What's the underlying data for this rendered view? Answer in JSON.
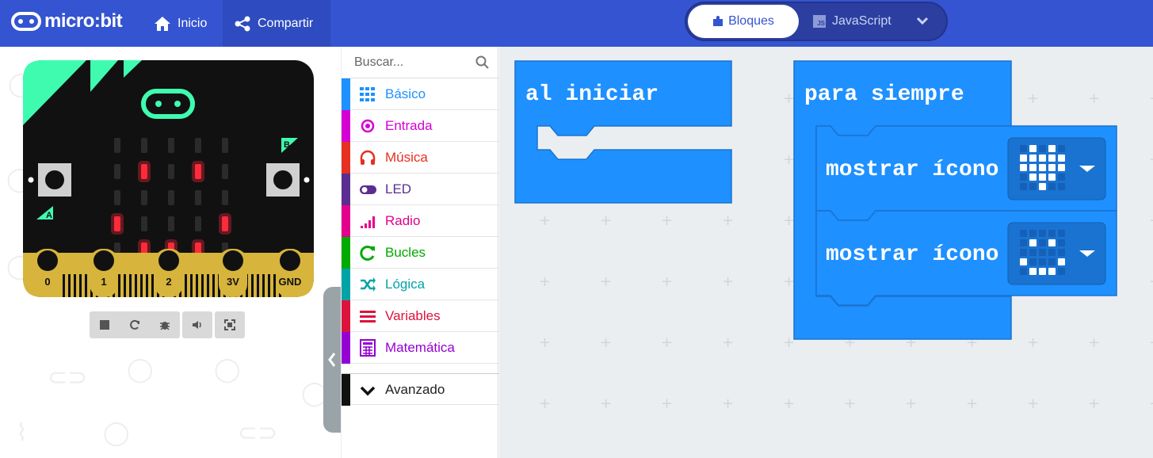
{
  "header": {
    "logo_text": "micro:bit",
    "home_label": "Inicio",
    "share_label": "Compartir",
    "blocks_label": "Bloques",
    "js_label": "JavaScript",
    "js_box": "JS"
  },
  "simulator": {
    "pins": [
      "0",
      "1",
      "2",
      "3V",
      "GND"
    ],
    "button_a": "A",
    "button_b": "B",
    "led_on": [
      [
        1,
        1
      ],
      [
        1,
        3
      ],
      [
        3,
        0
      ],
      [
        3,
        4
      ],
      [
        4,
        1
      ],
      [
        4,
        2
      ],
      [
        4,
        3
      ]
    ],
    "colors": {
      "board": "#111111",
      "accent": "#3ffbb0",
      "gold": "#d7b43b",
      "led": "#ff2a3a"
    }
  },
  "toolbox": {
    "search_placeholder": "Buscar...",
    "categories": [
      {
        "label": "Básico",
        "color": "#1e90ff",
        "icon": "grid-icon"
      },
      {
        "label": "Entrada",
        "color": "#d400d4",
        "icon": "target-icon"
      },
      {
        "label": "Música",
        "color": "#e63022",
        "icon": "headphones-icon"
      },
      {
        "label": "LED",
        "color": "#5c2d91",
        "icon": "toggle-icon"
      },
      {
        "label": "Radio",
        "color": "#e3008c",
        "icon": "signal-icon"
      },
      {
        "label": "Bucles",
        "color": "#00aa00",
        "icon": "refresh-icon"
      },
      {
        "label": "Lógica",
        "color": "#00a4a6",
        "icon": "shuffle-icon"
      },
      {
        "label": "Variables",
        "color": "#dc143c",
        "icon": "lines-icon"
      },
      {
        "label": "Matemática",
        "color": "#9400d3",
        "icon": "calculator-icon"
      }
    ],
    "advanced_label": "Avanzado"
  },
  "workspace": {
    "on_start_label": "al iniciar",
    "forever_label": "para siempre",
    "show_icon_label_1": "mostrar ícono",
    "show_icon_label_2": "mostrar ícono",
    "icon_1": [
      [
        0,
        1,
        0,
        1,
        0
      ],
      [
        1,
        1,
        1,
        1,
        1
      ],
      [
        1,
        1,
        1,
        1,
        1
      ],
      [
        0,
        1,
        1,
        1,
        0
      ],
      [
        0,
        0,
        1,
        0,
        0
      ]
    ],
    "icon_2": [
      [
        0,
        0,
        0,
        0,
        0
      ],
      [
        0,
        1,
        0,
        1,
        0
      ],
      [
        0,
        0,
        0,
        0,
        0
      ],
      [
        1,
        0,
        0,
        0,
        1
      ],
      [
        0,
        1,
        1,
        1,
        0
      ]
    ],
    "block_color": "#1e90ff"
  }
}
